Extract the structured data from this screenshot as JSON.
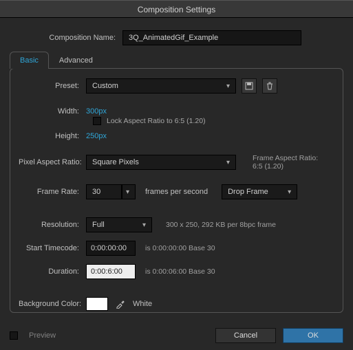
{
  "title": "Composition Settings",
  "compName": {
    "label": "Composition Name:",
    "value": "3Q_AnimatedGif_Example"
  },
  "tabs": {
    "basic": "Basic",
    "advanced": "Advanced"
  },
  "preset": {
    "label": "Preset:",
    "value": "Custom"
  },
  "width": {
    "label": "Width:",
    "value": "300",
    "unit": " px"
  },
  "height": {
    "label": "Height:",
    "value": "250",
    "unit": " px"
  },
  "lockAspect": "Lock Aspect Ratio to 6:5 (1.20)",
  "pixelAspect": {
    "label": "Pixel Aspect Ratio:",
    "value": "Square Pixels"
  },
  "frameAspect": {
    "l1": "Frame Aspect Ratio:",
    "l2": "6:5 (1.20)"
  },
  "frameRate": {
    "label": "Frame Rate:",
    "value": "30",
    "suffix": "frames per second",
    "mode": "Drop Frame"
  },
  "resolution": {
    "label": "Resolution:",
    "value": "Full",
    "info": "300 x 250, 292 KB per 8bpc frame"
  },
  "startTC": {
    "label": "Start Timecode:",
    "value": "0:00:00:00",
    "info": "is 0:00:00:00  Base 30"
  },
  "duration": {
    "label": "Duration:",
    "value": "0:00:6:00",
    "info": "is 0:00:06:00  Base 30"
  },
  "bgColor": {
    "label": "Background Color:",
    "name": "White"
  },
  "preview": "Preview",
  "cancel": "Cancel",
  "ok": "OK"
}
